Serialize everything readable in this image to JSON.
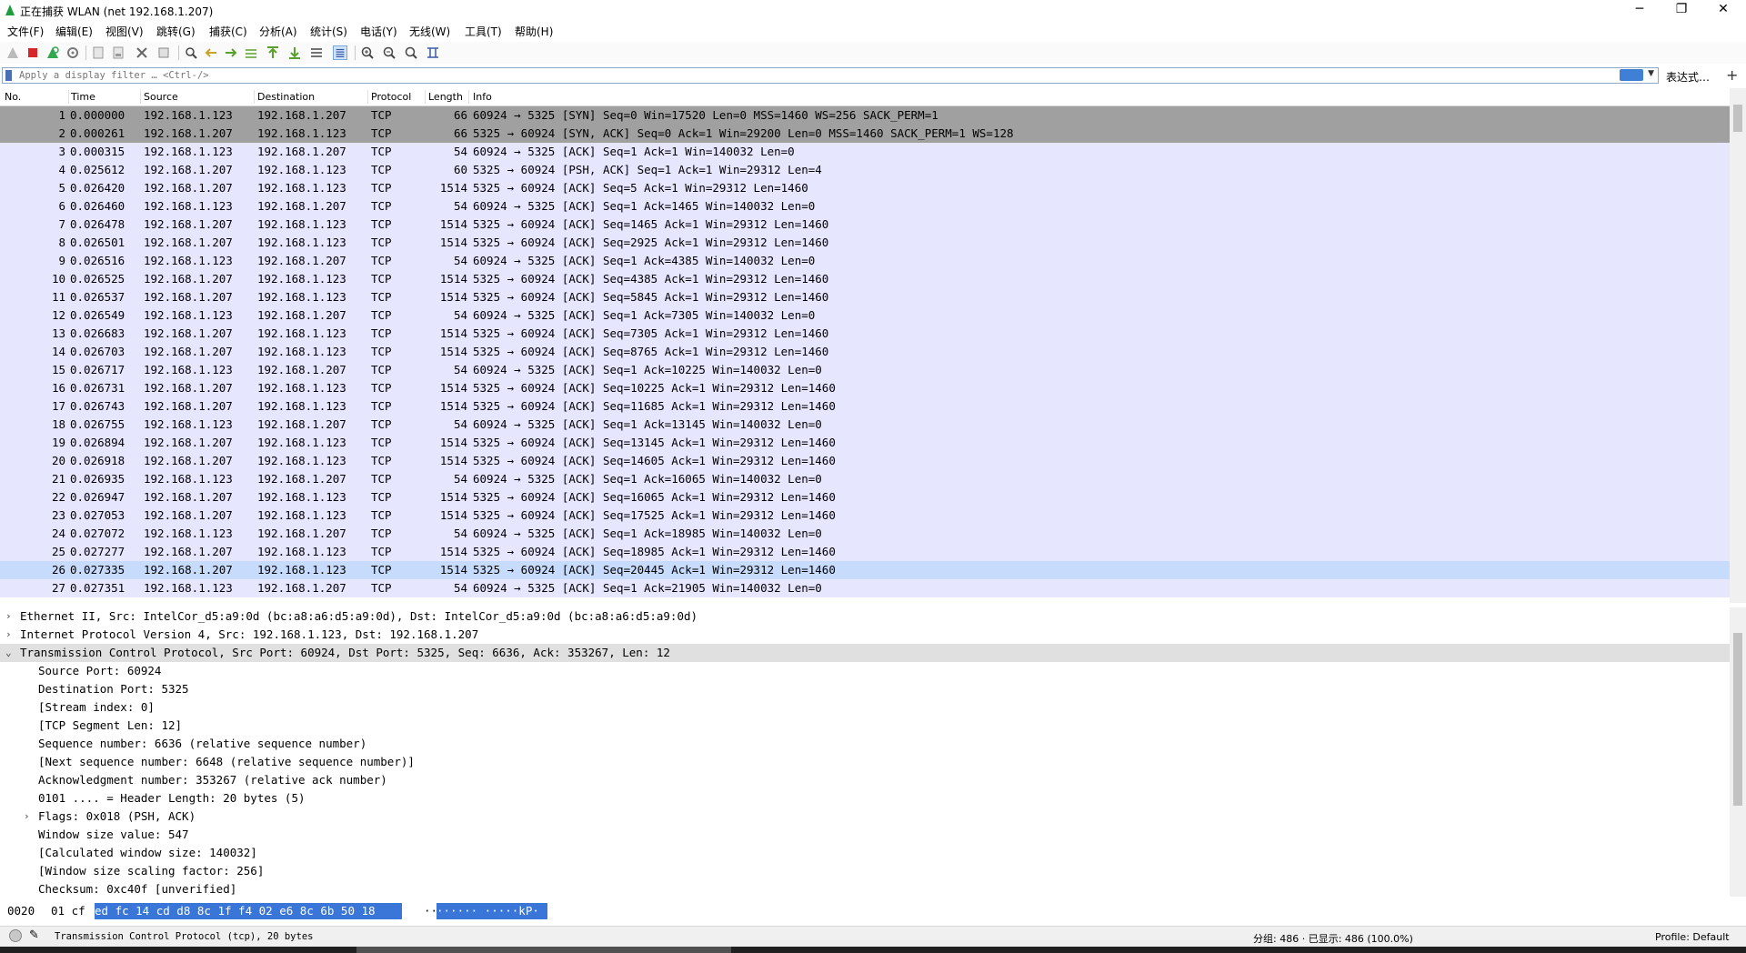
{
  "window": {
    "title": "正在捕获 WLAN (net 192.168.1.207)",
    "minimize": "─",
    "maximize": "❐",
    "close": "✕"
  },
  "menu": [
    "文件(F)",
    "编辑(E)",
    "视图(V)",
    "跳转(G)",
    "捕获(C)",
    "分析(A)",
    "统计(S)",
    "电话(Y)",
    "无线(W)",
    "工具(T)",
    "帮助(H)"
  ],
  "toolbar_icons": [
    "shark-fin-icon",
    "stop-icon",
    "restart-icon",
    "options-icon",
    "open-icon",
    "save-icon",
    "close-file-icon",
    "reload-icon",
    "find-icon",
    "back-icon",
    "forward-icon",
    "goto-icon",
    "first-icon",
    "last-icon",
    "autoscroll-icon",
    "colorize-icon",
    "zoom-in-icon",
    "zoom-out-icon",
    "normal-size-icon",
    "resize-columns-icon"
  ],
  "filter": {
    "placeholder": "Apply a display filter … <Ctrl-/>",
    "expression_label": "表达式…",
    "add_label": "+"
  },
  "packet_list": {
    "columns": [
      "No.",
      "Time",
      "Source",
      "Destination",
      "Protocol",
      "Length",
      "Info"
    ],
    "rows": [
      {
        "no": "1",
        "time": "0.000000",
        "src": "192.168.1.123",
        "dst": "192.168.1.207",
        "proto": "TCP",
        "len": "66",
        "info": "60924 → 5325 [SYN] Seq=0 Win=17520 Len=0 MSS=1460 WS=256 SACK_PERM=1",
        "style": "syn"
      },
      {
        "no": "2",
        "time": "0.000261",
        "src": "192.168.1.207",
        "dst": "192.168.1.123",
        "proto": "TCP",
        "len": "66",
        "info": "5325 → 60924 [SYN, ACK] Seq=0 Ack=1 Win=29200 Len=0 MSS=1460 SACK_PERM=1 WS=128",
        "style": "syn"
      },
      {
        "no": "3",
        "time": "0.000315",
        "src": "192.168.1.123",
        "dst": "192.168.1.207",
        "proto": "TCP",
        "len": "54",
        "info": "60924 → 5325 [ACK] Seq=1 Ack=1 Win=140032 Len=0",
        "style": "tcp"
      },
      {
        "no": "4",
        "time": "0.025612",
        "src": "192.168.1.207",
        "dst": "192.168.1.123",
        "proto": "TCP",
        "len": "60",
        "info": "5325 → 60924 [PSH, ACK] Seq=1 Ack=1 Win=29312 Len=4",
        "style": "tcp"
      },
      {
        "no": "5",
        "time": "0.026420",
        "src": "192.168.1.207",
        "dst": "192.168.1.123",
        "proto": "TCP",
        "len": "1514",
        "info": "5325 → 60924 [ACK] Seq=5 Ack=1 Win=29312 Len=1460",
        "style": "tcp"
      },
      {
        "no": "6",
        "time": "0.026460",
        "src": "192.168.1.123",
        "dst": "192.168.1.207",
        "proto": "TCP",
        "len": "54",
        "info": "60924 → 5325 [ACK] Seq=1 Ack=1465 Win=140032 Len=0",
        "style": "tcp"
      },
      {
        "no": "7",
        "time": "0.026478",
        "src": "192.168.1.207",
        "dst": "192.168.1.123",
        "proto": "TCP",
        "len": "1514",
        "info": "5325 → 60924 [ACK] Seq=1465 Ack=1 Win=29312 Len=1460",
        "style": "tcp"
      },
      {
        "no": "8",
        "time": "0.026501",
        "src": "192.168.1.207",
        "dst": "192.168.1.123",
        "proto": "TCP",
        "len": "1514",
        "info": "5325 → 60924 [ACK] Seq=2925 Ack=1 Win=29312 Len=1460",
        "style": "tcp"
      },
      {
        "no": "9",
        "time": "0.026516",
        "src": "192.168.1.123",
        "dst": "192.168.1.207",
        "proto": "TCP",
        "len": "54",
        "info": "60924 → 5325 [ACK] Seq=1 Ack=4385 Win=140032 Len=0",
        "style": "tcp"
      },
      {
        "no": "10",
        "time": "0.026525",
        "src": "192.168.1.207",
        "dst": "192.168.1.123",
        "proto": "TCP",
        "len": "1514",
        "info": "5325 → 60924 [ACK] Seq=4385 Ack=1 Win=29312 Len=1460",
        "style": "tcp"
      },
      {
        "no": "11",
        "time": "0.026537",
        "src": "192.168.1.207",
        "dst": "192.168.1.123",
        "proto": "TCP",
        "len": "1514",
        "info": "5325 → 60924 [ACK] Seq=5845 Ack=1 Win=29312 Len=1460",
        "style": "tcp"
      },
      {
        "no": "12",
        "time": "0.026549",
        "src": "192.168.1.123",
        "dst": "192.168.1.207",
        "proto": "TCP",
        "len": "54",
        "info": "60924 → 5325 [ACK] Seq=1 Ack=7305 Win=140032 Len=0",
        "style": "tcp"
      },
      {
        "no": "13",
        "time": "0.026683",
        "src": "192.168.1.207",
        "dst": "192.168.1.123",
        "proto": "TCP",
        "len": "1514",
        "info": "5325 → 60924 [ACK] Seq=7305 Ack=1 Win=29312 Len=1460",
        "style": "tcp"
      },
      {
        "no": "14",
        "time": "0.026703",
        "src": "192.168.1.207",
        "dst": "192.168.1.123",
        "proto": "TCP",
        "len": "1514",
        "info": "5325 → 60924 [ACK] Seq=8765 Ack=1 Win=29312 Len=1460",
        "style": "tcp"
      },
      {
        "no": "15",
        "time": "0.026717",
        "src": "192.168.1.123",
        "dst": "192.168.1.207",
        "proto": "TCP",
        "len": "54",
        "info": "60924 → 5325 [ACK] Seq=1 Ack=10225 Win=140032 Len=0",
        "style": "tcp"
      },
      {
        "no": "16",
        "time": "0.026731",
        "src": "192.168.1.207",
        "dst": "192.168.1.123",
        "proto": "TCP",
        "len": "1514",
        "info": "5325 → 60924 [ACK] Seq=10225 Ack=1 Win=29312 Len=1460",
        "style": "tcp"
      },
      {
        "no": "17",
        "time": "0.026743",
        "src": "192.168.1.207",
        "dst": "192.168.1.123",
        "proto": "TCP",
        "len": "1514",
        "info": "5325 → 60924 [ACK] Seq=11685 Ack=1 Win=29312 Len=1460",
        "style": "tcp"
      },
      {
        "no": "18",
        "time": "0.026755",
        "src": "192.168.1.123",
        "dst": "192.168.1.207",
        "proto": "TCP",
        "len": "54",
        "info": "60924 → 5325 [ACK] Seq=1 Ack=13145 Win=140032 Len=0",
        "style": "tcp"
      },
      {
        "no": "19",
        "time": "0.026894",
        "src": "192.168.1.207",
        "dst": "192.168.1.123",
        "proto": "TCP",
        "len": "1514",
        "info": "5325 → 60924 [ACK] Seq=13145 Ack=1 Win=29312 Len=1460",
        "style": "tcp"
      },
      {
        "no": "20",
        "time": "0.026918",
        "src": "192.168.1.207",
        "dst": "192.168.1.123",
        "proto": "TCP",
        "len": "1514",
        "info": "5325 → 60924 [ACK] Seq=14605 Ack=1 Win=29312 Len=1460",
        "style": "tcp"
      },
      {
        "no": "21",
        "time": "0.026935",
        "src": "192.168.1.123",
        "dst": "192.168.1.207",
        "proto": "TCP",
        "len": "54",
        "info": "60924 → 5325 [ACK] Seq=1 Ack=16065 Win=140032 Len=0",
        "style": "tcp"
      },
      {
        "no": "22",
        "time": "0.026947",
        "src": "192.168.1.207",
        "dst": "192.168.1.123",
        "proto": "TCP",
        "len": "1514",
        "info": "5325 → 60924 [ACK] Seq=16065 Ack=1 Win=29312 Len=1460",
        "style": "tcp"
      },
      {
        "no": "23",
        "time": "0.027053",
        "src": "192.168.1.207",
        "dst": "192.168.1.123",
        "proto": "TCP",
        "len": "1514",
        "info": "5325 → 60924 [ACK] Seq=17525 Ack=1 Win=29312 Len=1460",
        "style": "tcp"
      },
      {
        "no": "24",
        "time": "0.027072",
        "src": "192.168.1.123",
        "dst": "192.168.1.207",
        "proto": "TCP",
        "len": "54",
        "info": "60924 → 5325 [ACK] Seq=1 Ack=18985 Win=140032 Len=0",
        "style": "tcp"
      },
      {
        "no": "25",
        "time": "0.027277",
        "src": "192.168.1.207",
        "dst": "192.168.1.123",
        "proto": "TCP",
        "len": "1514",
        "info": "5325 → 60924 [ACK] Seq=18985 Ack=1 Win=29312 Len=1460",
        "style": "tcp"
      },
      {
        "no": "26",
        "time": "0.027335",
        "src": "192.168.1.207",
        "dst": "192.168.1.123",
        "proto": "TCP",
        "len": "1514",
        "info": "5325 → 60924 [ACK] Seq=20445 Ack=1 Win=29312 Len=1460",
        "style": "related"
      },
      {
        "no": "27",
        "time": "0.027351",
        "src": "192.168.1.123",
        "dst": "192.168.1.207",
        "proto": "TCP",
        "len": "54",
        "info": "60924 → 5325 [ACK] Seq=1 Ack=21905 Win=140032 Len=0",
        "style": "tcp"
      }
    ]
  },
  "details": [
    {
      "indent": 0,
      "arrow": "›",
      "text": "Ethernet II, Src: IntelCor_d5:a9:0d (bc:a8:a6:d5:a9:0d), Dst: IntelCor_d5:a9:0d (bc:a8:a6:d5:a9:0d)"
    },
    {
      "indent": 0,
      "arrow": "›",
      "text": "Internet Protocol Version 4, Src: 192.168.1.123, Dst: 192.168.1.207"
    },
    {
      "indent": 0,
      "arrow": "⌄",
      "text": "Transmission Control Protocol, Src Port: 60924, Dst Port: 5325, Seq: 6636, Ack: 353267, Len: 12",
      "selected": true
    },
    {
      "indent": 1,
      "arrow": "",
      "text": "Source Port: 60924"
    },
    {
      "indent": 1,
      "arrow": "",
      "text": "Destination Port: 5325"
    },
    {
      "indent": 1,
      "arrow": "",
      "text": "[Stream index: 0]"
    },
    {
      "indent": 1,
      "arrow": "",
      "text": "[TCP Segment Len: 12]"
    },
    {
      "indent": 1,
      "arrow": "",
      "text": "Sequence number: 6636    (relative sequence number)"
    },
    {
      "indent": 1,
      "arrow": "",
      "text": "[Next sequence number: 6648    (relative sequence number)]"
    },
    {
      "indent": 1,
      "arrow": "",
      "text": "Acknowledgment number: 353267    (relative ack number)"
    },
    {
      "indent": 1,
      "arrow": "",
      "text": "0101 .... = Header Length: 20 bytes (5)"
    },
    {
      "indent": 1,
      "arrow": "›",
      "text": "Flags: 0x018 (PSH, ACK)"
    },
    {
      "indent": 1,
      "arrow": "",
      "text": "Window size value: 547"
    },
    {
      "indent": 1,
      "arrow": "",
      "text": "[Calculated window size: 140032]"
    },
    {
      "indent": 1,
      "arrow": "",
      "text": "[Window size scaling factor: 256]"
    },
    {
      "indent": 1,
      "arrow": "",
      "text": "Checksum: 0xc40f [unverified]"
    }
  ],
  "bytes": {
    "offset": "0020",
    "pre": "01 cf",
    "highlight_hex": "ed fc 14 cd d8 8c  1f f4 02 e6 8c 6b 50 18",
    "ascii_pre": "··",
    "highlight_ascii": "······ ·····kP·"
  },
  "status": {
    "left_text": "Transmission Control Protocol (tcp), 20 bytes",
    "packets_text": "分组: 486 · 已显示: 486 (100.0%)",
    "profile_text": "Profile: Default"
  }
}
